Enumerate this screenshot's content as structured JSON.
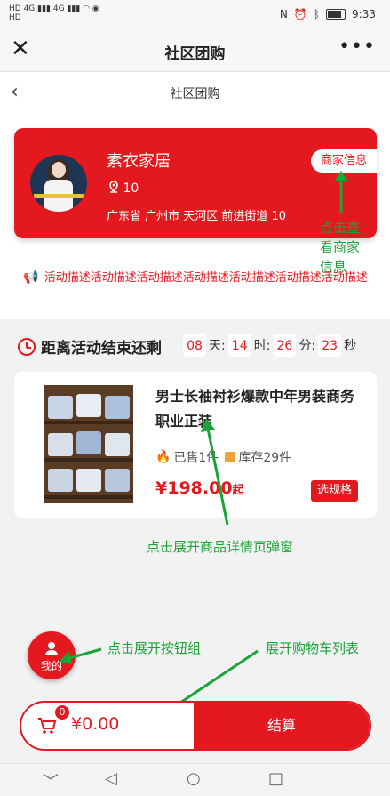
{
  "status_bar": {
    "left_line1": "HD",
    "left_line2": "HD",
    "signal_a": "4G",
    "signal_b": "4G",
    "time": "9:33"
  },
  "app_bar": {
    "close_glyph": "✕",
    "title": "社区团购",
    "more_glyph": "•••"
  },
  "sub_header": {
    "back_glyph": "‹",
    "title": "社区团购"
  },
  "merchant": {
    "name": "素衣家居",
    "number": "10",
    "address": "广东省 广州市 天河区 前进街道 10",
    "info_button": "商家信息"
  },
  "activity_description": "活动描述活动描述活动描述活动描述活动描述活动描述活动描述",
  "countdown": {
    "label": "距离活动结束还剩",
    "days": "08",
    "days_unit": "天:",
    "hours": "14",
    "hours_unit": "时:",
    "minutes": "26",
    "minutes_unit": "分:",
    "seconds": "23",
    "seconds_unit": "秒"
  },
  "product": {
    "title": "男士长袖衬衫爆款中年男装商务职业正装",
    "sold": "已售1件",
    "stock": "库存29件",
    "price": "¥198.00",
    "price_suffix": "起",
    "select_spec": "选规格"
  },
  "annotations": {
    "merchant_info_line1": "点击查",
    "merchant_info_line2": "看商家",
    "merchant_info_line3": "信息",
    "product_detail": "点击展开商品详情页弹窗",
    "button_group": "点击展开按钮组",
    "cart_list": "展开购物车列表"
  },
  "fab": {
    "label": "我的"
  },
  "cart": {
    "badge": "0",
    "amount": "¥0.00",
    "checkout": "结算"
  },
  "nav_bar": {
    "down": "﹀",
    "back": "◁",
    "home": "○",
    "recent": "□"
  },
  "colors": {
    "accent": "#e41920",
    "annotation": "#1ba33a"
  },
  "icons": [
    "close-icon",
    "more-icon",
    "back-icon",
    "location-pin-icon",
    "megaphone-icon",
    "alarm-clock-icon",
    "fire-icon",
    "box-icon",
    "person-icon",
    "cart-icon",
    "arrow-icon"
  ]
}
